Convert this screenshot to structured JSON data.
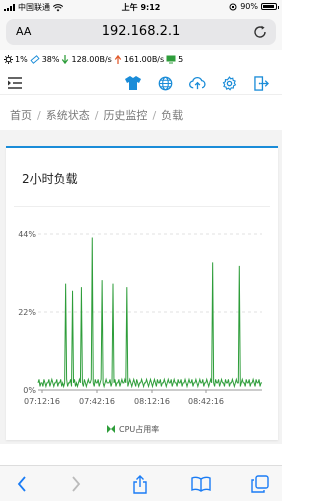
{
  "status_bar": {
    "carrier": "中国联通",
    "time": "上午 9:12",
    "battery": "90%"
  },
  "browser": {
    "aa_label": "AA",
    "url": "192.168.2.1"
  },
  "toolbar": {
    "cpu": "1%",
    "mem": "38%",
    "download": "128.00B/s",
    "upload": "161.00B/s",
    "clients": "5",
    "icons": [
      "shirt-icon",
      "globe-icon",
      "cloud-upload-icon",
      "gear-icon",
      "logout-icon"
    ],
    "colors": {
      "accent": "#1a8cd8",
      "download": "#2e9d3a",
      "upload": "#e05a2b"
    }
  },
  "breadcrumb": [
    "首页",
    "系统状态",
    "历史监控",
    "负载"
  ],
  "card": {
    "title": "2小时负载"
  },
  "chart_data": {
    "type": "line",
    "title": "",
    "legend": [
      "CPU占用率"
    ],
    "legend_position": "bottom",
    "color": "#2e9d3a",
    "grid": true,
    "y_ticks": [
      "0%",
      "22%",
      "44%"
    ],
    "ylim": [
      0,
      44
    ],
    "x_ticks": [
      "07:12:16",
      "07:42:16",
      "08:12:16",
      "08:42:16"
    ],
    "series": [
      {
        "name": "CPU占用率",
        "values": [
          2,
          3,
          1,
          2,
          2,
          1,
          3,
          2,
          1,
          2,
          2,
          3,
          1,
          2,
          3,
          2,
          1,
          2,
          2,
          3,
          1,
          2,
          2,
          3,
          1,
          2,
          1,
          2,
          30,
          3,
          1,
          2,
          2,
          3,
          1,
          28,
          2,
          3,
          1,
          2,
          1,
          2,
          3,
          2,
          29,
          2,
          1,
          3,
          2,
          1,
          2,
          3,
          2,
          2,
          3,
          43,
          2,
          1,
          3,
          2,
          2,
          3,
          1,
          2,
          3,
          31,
          2,
          1,
          2,
          3,
          2,
          2,
          2,
          3,
          1,
          2,
          30,
          2,
          3,
          1,
          2,
          2,
          3,
          1,
          2,
          3,
          2,
          2,
          3,
          2,
          29,
          1,
          2,
          3,
          2,
          1,
          2,
          3,
          2,
          1,
          3,
          2,
          1,
          2,
          2,
          3,
          2,
          1,
          2,
          2,
          3,
          2,
          1,
          2,
          3,
          2,
          1,
          2,
          3,
          2,
          1,
          3,
          2,
          2,
          3,
          1,
          2,
          2,
          3,
          2,
          1,
          2,
          3,
          2,
          2,
          3,
          1,
          2,
          3,
          2,
          2,
          1,
          3,
          2,
          2,
          3,
          1,
          2,
          2,
          3,
          2,
          1,
          2,
          3,
          2,
          2,
          3,
          1,
          2,
          2,
          3,
          2,
          1,
          2,
          3,
          2,
          2,
          3,
          1,
          2,
          2,
          3,
          2,
          1,
          2,
          3,
          2,
          36,
          2,
          1,
          3,
          2,
          2,
          3,
          1,
          2,
          3,
          2,
          2,
          1,
          3,
          2,
          2,
          3,
          1,
          2,
          2,
          3,
          2,
          1,
          2,
          3,
          2,
          2,
          35,
          1,
          2,
          3,
          2,
          2,
          1,
          3,
          2,
          2,
          3,
          1,
          2,
          2,
          3,
          2,
          1,
          3,
          2,
          2,
          3,
          1,
          2,
          2
        ]
      }
    ]
  }
}
